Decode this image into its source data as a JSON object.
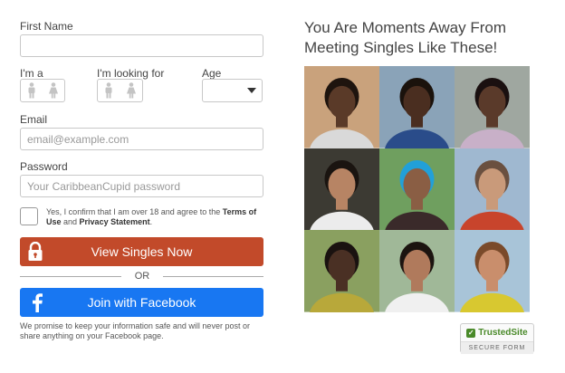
{
  "form": {
    "first_name_label": "First Name",
    "first_name_value": "",
    "gender_label": "I'm a",
    "seeking_label": "I'm looking for",
    "age_label": "Age",
    "age_value": "",
    "email_label": "Email",
    "email_placeholder": "email@example.com",
    "password_label": "Password",
    "password_placeholder": "Your CaribbeanCupid password",
    "confirm_prefix": "Yes, I confirm that I am over 18 and agree to the ",
    "terms_link": "Terms of Use",
    "confirm_and": " and ",
    "privacy_link": "Privacy Statement",
    "confirm_suffix": ".",
    "view_button": "View Singles Now",
    "or_text": "OR",
    "facebook_button": "Join with Facebook",
    "promise_text": "We promise to keep your information safe and will never post or share anything on your Facebook page."
  },
  "promo": {
    "headline": "You Are Moments Away From Meeting Singles Like These!",
    "photos": [
      {
        "name": "single-photo-1",
        "bg": "#c9a27c",
        "skin": "#5a3a28",
        "shirt": "#d9d9d9",
        "hair": "#1e140e"
      },
      {
        "name": "single-photo-2",
        "bg": "#8aa3b8",
        "skin": "#4a2e20",
        "shirt": "#2a4c8a",
        "hair": "#1a120c"
      },
      {
        "name": "single-photo-3",
        "bg": "#9fa7a0",
        "skin": "#5a3a2a",
        "shirt": "#c8b0c8",
        "hair": "#1a1010"
      },
      {
        "name": "single-photo-4",
        "bg": "#3c3a33",
        "skin": "#b78464",
        "shirt": "#ececec",
        "hair": "#1a1410"
      },
      {
        "name": "single-photo-5",
        "bg": "#6f9f5f",
        "skin": "#8a5e44",
        "shirt": "#3a2a2a",
        "hair": "#22a0d8"
      },
      {
        "name": "single-photo-6",
        "bg": "#9fb8d0",
        "skin": "#c99a7a",
        "shirt": "#c8442c",
        "hair": "#6a5040"
      },
      {
        "name": "single-photo-7",
        "bg": "#8aa060",
        "skin": "#4a3024",
        "shirt": "#b8a83a",
        "hair": "#1a1210"
      },
      {
        "name": "single-photo-8",
        "bg": "#a0b898",
        "skin": "#b07a5c",
        "shirt": "#f0f0f0",
        "hair": "#1c1410"
      },
      {
        "name": "single-photo-9",
        "bg": "#a8c4d8",
        "skin": "#c98e6c",
        "shirt": "#d8c830",
        "hair": "#7a4a2a"
      }
    ]
  },
  "badge": {
    "title": "TrustedSite",
    "subtitle": "SECURE FORM",
    "accent": "#4a8a2a"
  },
  "colors": {
    "view_button": "#c24a2a",
    "facebook_button": "#1877f2"
  }
}
